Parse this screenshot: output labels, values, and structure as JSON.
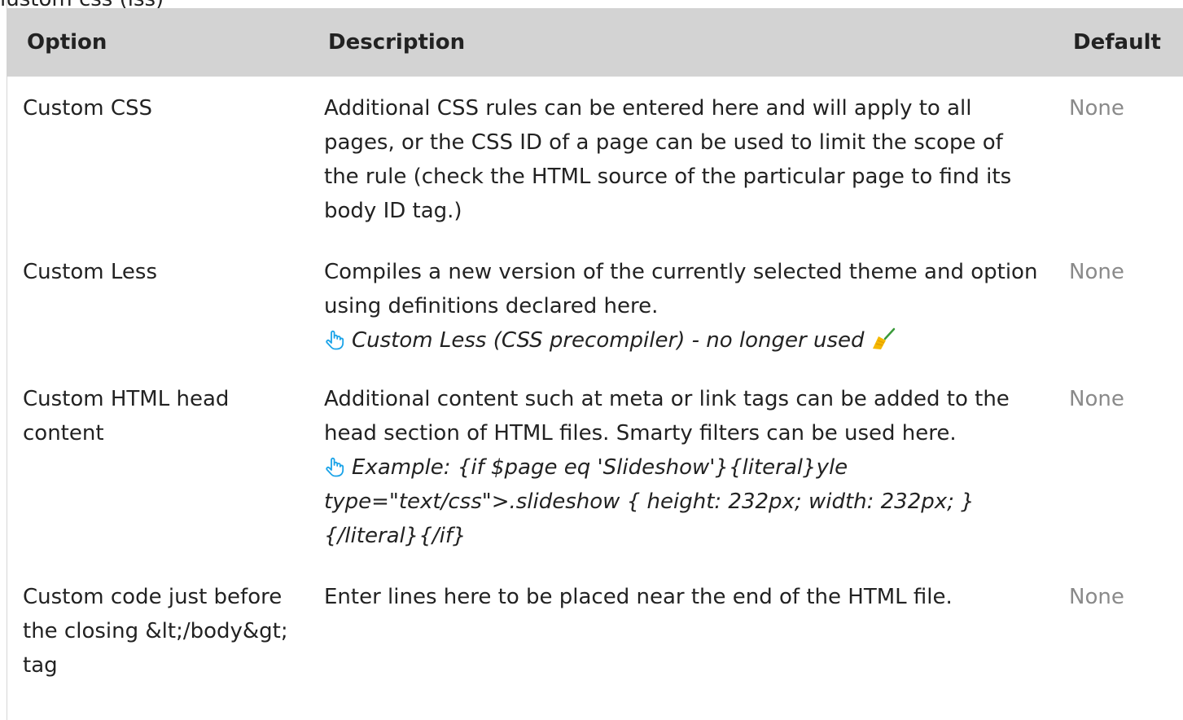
{
  "top_clipped_text": "lustom css (lss)",
  "table": {
    "headers": {
      "option": "Option",
      "description": "Description",
      "default": "Default"
    },
    "rows": [
      {
        "option": "Custom CSS",
        "description": "Additional CSS rules can be entered here and will apply to all pages, or the CSS ID of a page can be used to limit the scope of the rule (check the HTML source of the particular page to find its body ID tag.)",
        "default": "None"
      },
      {
        "option": "Custom Less",
        "description": "Compiles a new version of the currently selected theme and option using definitions declared here.",
        "tip": "Custom Less (CSS precompiler) - no longer used",
        "tip_icon": "hand-pointer-icon",
        "tip_trailing_icon": "broom-icon",
        "default": "None"
      },
      {
        "option": "Custom HTML head content",
        "description": "Additional content such at meta or link tags can be added to the head section of HTML files. Smarty filters can be used here.",
        "tip": "Example: {if $page eq 'Slideshow'}{literal}yle type=\"text/css\">.slideshow { height: 232px; width: 232px; }{/literal}{/if}",
        "tip_icon": "hand-pointer-icon",
        "default": "None"
      },
      {
        "option": "Custom code just before the closing &lt;/body&gt; tag",
        "description": "Enter lines here to be placed near the end of the HTML file.",
        "default": "None"
      }
    ]
  },
  "colors": {
    "header_bg": "#d3d3d3",
    "text": "#222222",
    "default_text": "#8a8a8a",
    "icon_blue": "#1aa3e8",
    "broom_yellow": "#f5b800"
  }
}
